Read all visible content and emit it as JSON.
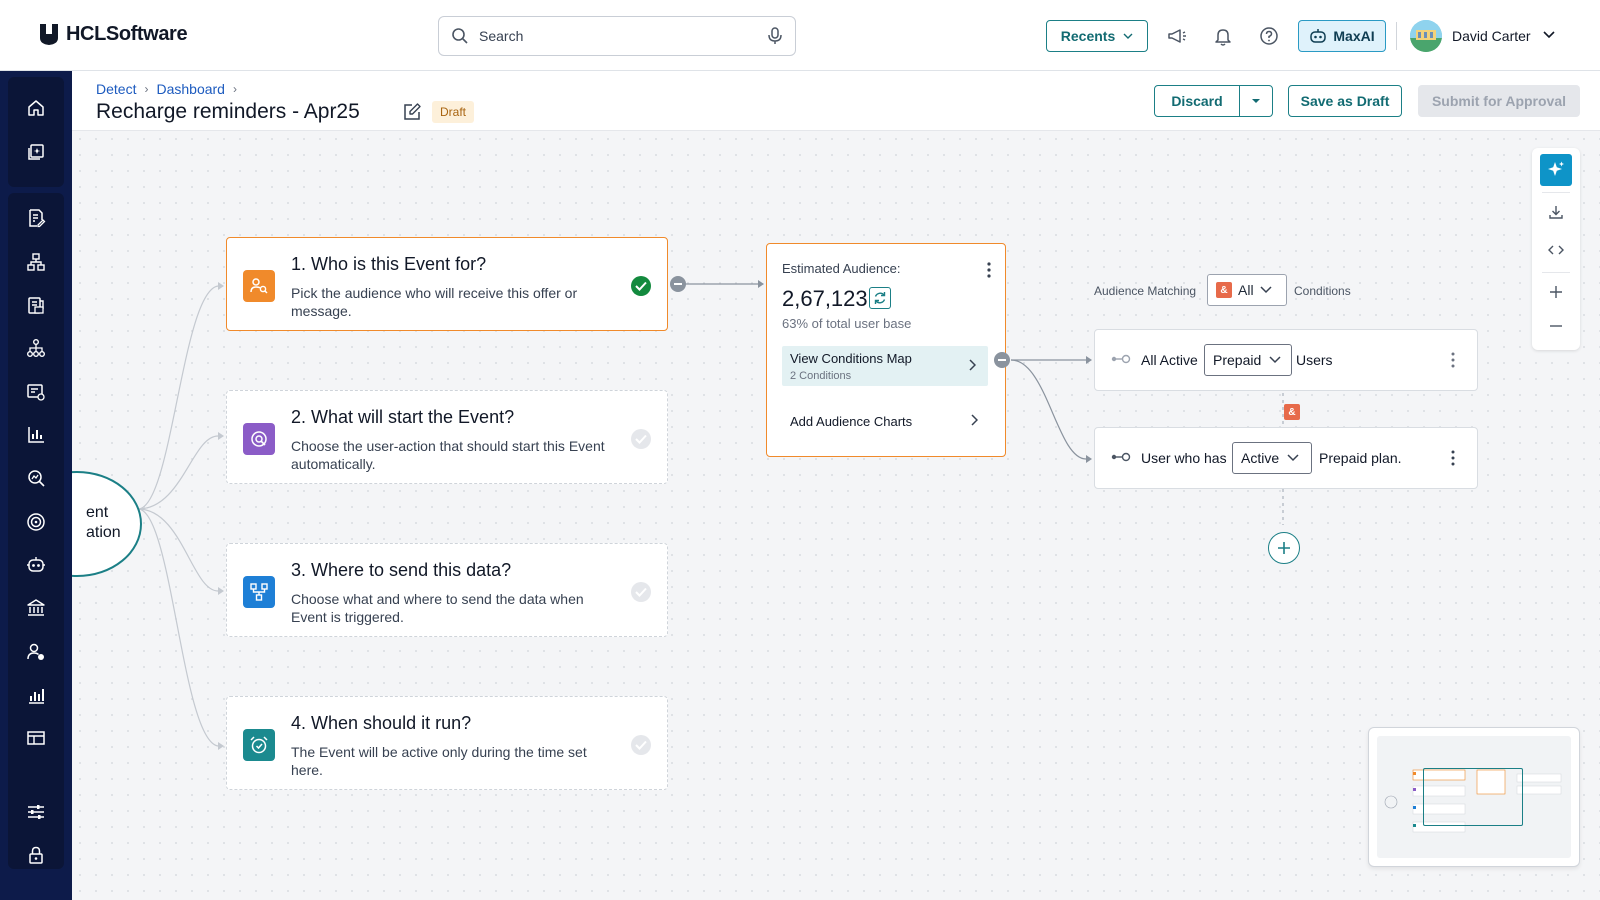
{
  "app": {
    "logo_text": "HCLSoftware"
  },
  "search": {
    "placeholder": "Search"
  },
  "topbar": {
    "recents_label": "Recents",
    "maxai_label": "MaxAI",
    "user_name": "David Carter"
  },
  "sidebar": {
    "items": [
      "home-icon",
      "campaign-icon",
      "document-edit-icon",
      "org-chart-icon",
      "report-icon",
      "hierarchy-icon",
      "list-settings-icon",
      "bar-chart-icon",
      "search-analytics-icon",
      "target-icon",
      "bot-icon",
      "bank-icon",
      "user-settings-icon",
      "analytics-icon",
      "table-icon",
      "sliders-icon",
      "lock-icon"
    ]
  },
  "breadcrumb": {
    "items": [
      "Detect",
      "Dashboard"
    ]
  },
  "page": {
    "title": "Recharge reminders - Apr25",
    "status_badge": "Draft"
  },
  "actions": {
    "discard": "Discard",
    "save_draft": "Save as Draft",
    "submit": "Submit for Approval"
  },
  "start_node": {
    "line1": "ent",
    "line2": "ation"
  },
  "steps": [
    {
      "title": "1. Who is this Event for?",
      "desc": "Pick the audience who will receive this offer or message.",
      "icon": "audience-icon",
      "color": "#f08a2b",
      "done": true
    },
    {
      "title": "2. What will start the Event?",
      "desc": "Choose the user-action that should start this Event automatically.",
      "icon": "trigger-icon",
      "color": "#8b5cc7",
      "done": false
    },
    {
      "title": "3. Where to send this data?",
      "desc": "Choose what and where to send the data when Event is triggered.",
      "icon": "destination-icon",
      "color": "#1e7fd6",
      "done": false
    },
    {
      "title": "4. When should it run?",
      "desc": "The Event will be active only during the time set here.",
      "icon": "alarm-icon",
      "color": "#1b8a8f",
      "done": false
    }
  ],
  "audience": {
    "label": "Estimated Audience:",
    "count": "2,67,123",
    "percent_text": "63% of total user base",
    "map_title": "View Conditions Map",
    "map_sub": "2 Conditions",
    "charts_label": "Add Audience Charts"
  },
  "matching": {
    "label": "Audience Matching",
    "value": "All",
    "amp": "&",
    "conditions_label": "Conditions"
  },
  "conditions": [
    {
      "prefix": "All Active",
      "select": "Prepaid",
      "suffix": "Users"
    },
    {
      "prefix": "User who has",
      "select": "Active",
      "suffix": "Prepaid plan."
    }
  ],
  "colors": {
    "accent": "#1b7f86",
    "active_border": "#f08a2b",
    "sidebar_bg": "#0d1b4a",
    "amp": "#e76a4a"
  }
}
